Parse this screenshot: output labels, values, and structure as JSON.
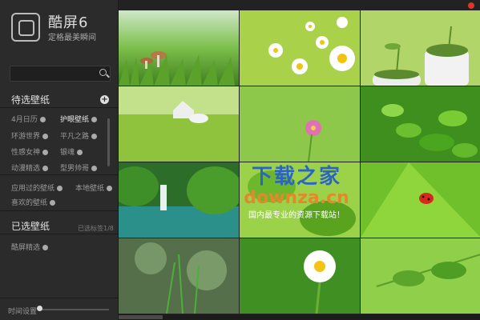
{
  "app": {
    "title": "酷屏6",
    "slogan": "定格最美瞬间"
  },
  "search": {
    "value": "",
    "placeholder": ""
  },
  "candidate": {
    "title": "待选壁纸",
    "items": [
      "4月日历",
      "护眼壁纸",
      "环游世界",
      "平凡之路",
      "性感女神",
      "银魂",
      "动漫精选",
      "型男帅哥",
      "应用过的壁纸",
      "本地壁纸",
      "喜欢的壁纸"
    ],
    "active": "护眼壁纸"
  },
  "selected": {
    "title": "已选壁纸",
    "note": "已选标签1/8",
    "items": [
      "酷屏精选"
    ]
  },
  "footer": {
    "time_setting": "时间设置"
  },
  "watermark": {
    "line1": "下载之家",
    "line2": "downza.cn",
    "line3": "国内最专业的资源下载站！"
  },
  "colors": {
    "sidebar": "#2b2b2b",
    "accent": "#d9372b"
  },
  "wallpapers": [
    {
      "name": "mushrooms-grass"
    },
    {
      "name": "daisies"
    },
    {
      "name": "potted-sprouts"
    },
    {
      "name": "house-on-lawn"
    },
    {
      "name": "pink-flower"
    },
    {
      "name": "tea-leaves"
    },
    {
      "name": "waterfall-river"
    },
    {
      "name": "green-leaves"
    },
    {
      "name": "ladybug-leaf"
    },
    {
      "name": "grass-stems-bokeh"
    },
    {
      "name": "white-daisy"
    },
    {
      "name": "leaf-branch"
    }
  ]
}
